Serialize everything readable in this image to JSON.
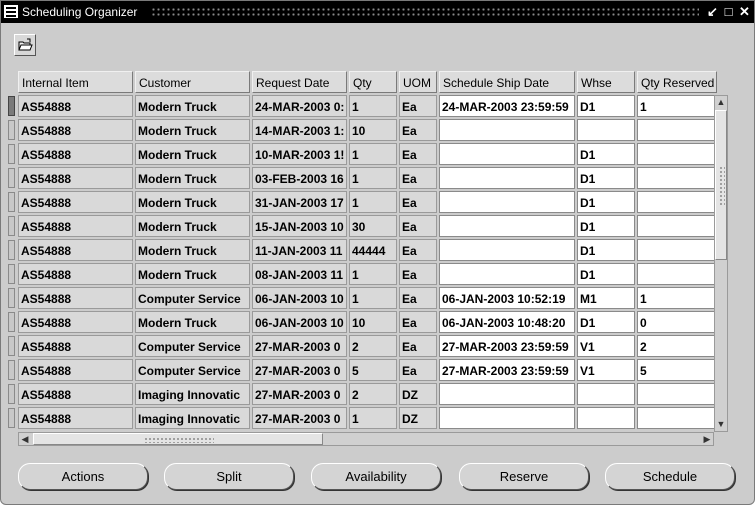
{
  "window": {
    "title": "Scheduling Organizer"
  },
  "columns": [
    "Internal Item",
    "Customer",
    "Request Date",
    "Qty",
    "UOM",
    "Schedule Ship Date",
    "Whse",
    "Qty Reserved"
  ],
  "rows": [
    [
      "AS54888",
      "Modern Truck",
      "24-MAR-2003 0:",
      "1",
      "Ea",
      "24-MAR-2003 23:59:59",
      "D1",
      "1"
    ],
    [
      "AS54888",
      "Modern Truck",
      "14-MAR-2003 1:",
      "10",
      "Ea",
      "",
      "",
      ""
    ],
    [
      "AS54888",
      "Modern Truck",
      "10-MAR-2003 1!",
      "1",
      "Ea",
      "",
      "D1",
      ""
    ],
    [
      "AS54888",
      "Modern Truck",
      "03-FEB-2003 16",
      "1",
      "Ea",
      "",
      "D1",
      ""
    ],
    [
      "AS54888",
      "Modern Truck",
      "31-JAN-2003 17",
      "1",
      "Ea",
      "",
      "D1",
      ""
    ],
    [
      "AS54888",
      "Modern Truck",
      "15-JAN-2003 10",
      "30",
      "Ea",
      "",
      "D1",
      ""
    ],
    [
      "AS54888",
      "Modern Truck",
      "11-JAN-2003 11",
      "44444",
      "Ea",
      "",
      "D1",
      ""
    ],
    [
      "AS54888",
      "Modern Truck",
      "08-JAN-2003 11",
      "1",
      "Ea",
      "",
      "D1",
      ""
    ],
    [
      "AS54888",
      "Computer Service",
      "06-JAN-2003 10",
      "1",
      "Ea",
      "06-JAN-2003 10:52:19",
      "M1",
      "1"
    ],
    [
      "AS54888",
      "Modern Truck",
      "06-JAN-2003 10",
      "10",
      "Ea",
      "06-JAN-2003 10:48:20",
      "D1",
      "0"
    ],
    [
      "AS54888",
      "Computer Service",
      "27-MAR-2003 0",
      "2",
      "Ea",
      "27-MAR-2003 23:59:59",
      "V1",
      "2"
    ],
    [
      "AS54888",
      "Computer Service",
      "27-MAR-2003 0",
      "5",
      "Ea",
      "27-MAR-2003 23:59:59",
      "V1",
      "5"
    ],
    [
      "AS54888",
      "Imaging Innovatic",
      "27-MAR-2003 0",
      "2",
      "DZ",
      "",
      "",
      ""
    ],
    [
      "AS54888",
      "Imaging Innovatic",
      "27-MAR-2003 0",
      "1",
      "DZ",
      "",
      "",
      ""
    ]
  ],
  "buttons": {
    "actions": "Actions",
    "split": "Split",
    "availability": "Availability",
    "reserve": "Reserve",
    "schedule": "Schedule"
  }
}
